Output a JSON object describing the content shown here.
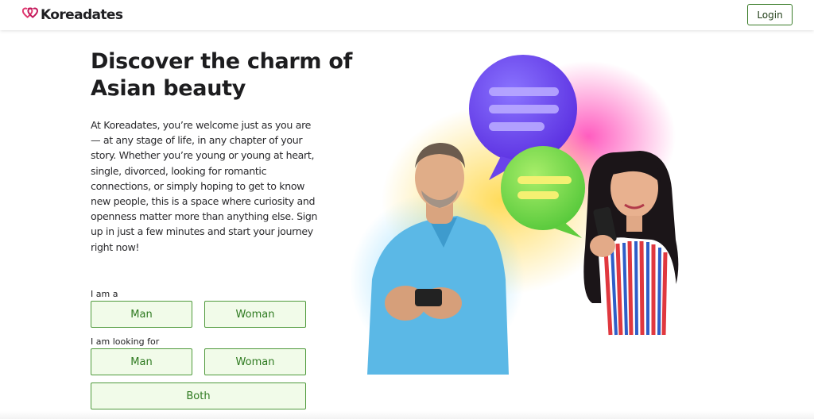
{
  "header": {
    "brand": "Koreadates",
    "login_label": "Login"
  },
  "hero": {
    "headline": "Discover the charm of Asian beauty",
    "intro": "At Koreadates, you’re welcome just as you are — at any stage of life, in any chapter of your story. Whether you’re young or young at heart, single, divorced, looking for romantic connections, or simply hoping to get to know new people, this is a space where curiosity and openness matter more than anything else. Sign up in just a few minutes and start your journey right now!"
  },
  "form": {
    "i_am_label": "I am a",
    "i_am_options": [
      "Man",
      "Woman"
    ],
    "looking_for_label": "I am looking for",
    "looking_for_options": [
      "Man",
      "Woman",
      "Both"
    ]
  },
  "colors": {
    "accent_green": "#4f9a3c",
    "option_bg": "#f1fbe9",
    "brand_heart": "#e0386f"
  },
  "icons": {
    "logo": "heart-icon",
    "bubble_purple": "chat-bubble-icon",
    "bubble_green": "chat-bubble-icon"
  }
}
